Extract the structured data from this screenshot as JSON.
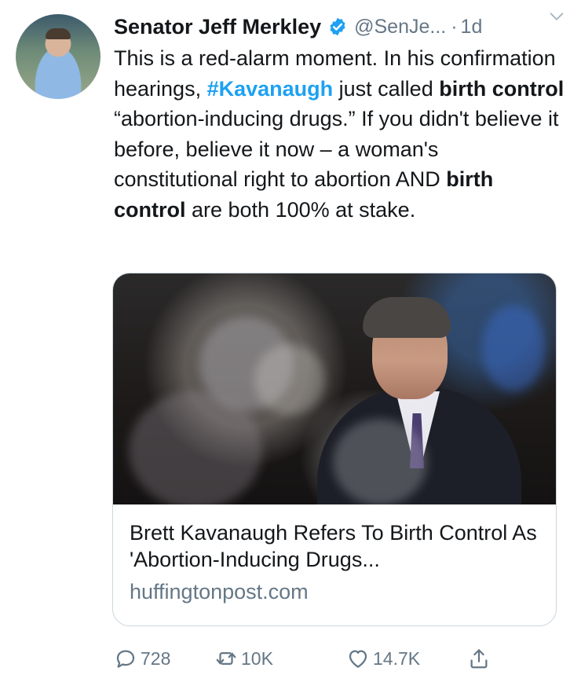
{
  "tweet": {
    "author_name": "Senator Jeff Merkley",
    "handle": "@SenJe...",
    "separator": "·",
    "time": "1d",
    "body": {
      "p1": "This is a red-alarm moment. In his confirmation hearings, ",
      "hashtag": "#Kavanaugh",
      "p2": " just called ",
      "bold1": "birth control",
      "p3": " “abortion-inducing drugs.” If you didn't believe it before, believe it now – a woman's constitutional right to abortion AND ",
      "bold2": "birth control",
      "p4": " are both 100% at stake."
    },
    "card": {
      "title": "Brett Kavanaugh Refers To Birth Control As 'Abortion-Inducing Drugs...",
      "domain": "huffingtonpost.com"
    },
    "actions": {
      "replies": "728",
      "retweets": "10K",
      "likes": "14.7K"
    }
  },
  "colors": {
    "text": "#14171a",
    "muted": "#657786",
    "accent": "#1da1f2",
    "border": "#ccd6dd"
  },
  "icons": [
    "verified-badge-icon",
    "chevron-down-icon",
    "reply-icon",
    "retweet-icon",
    "heart-icon",
    "share-icon"
  ]
}
